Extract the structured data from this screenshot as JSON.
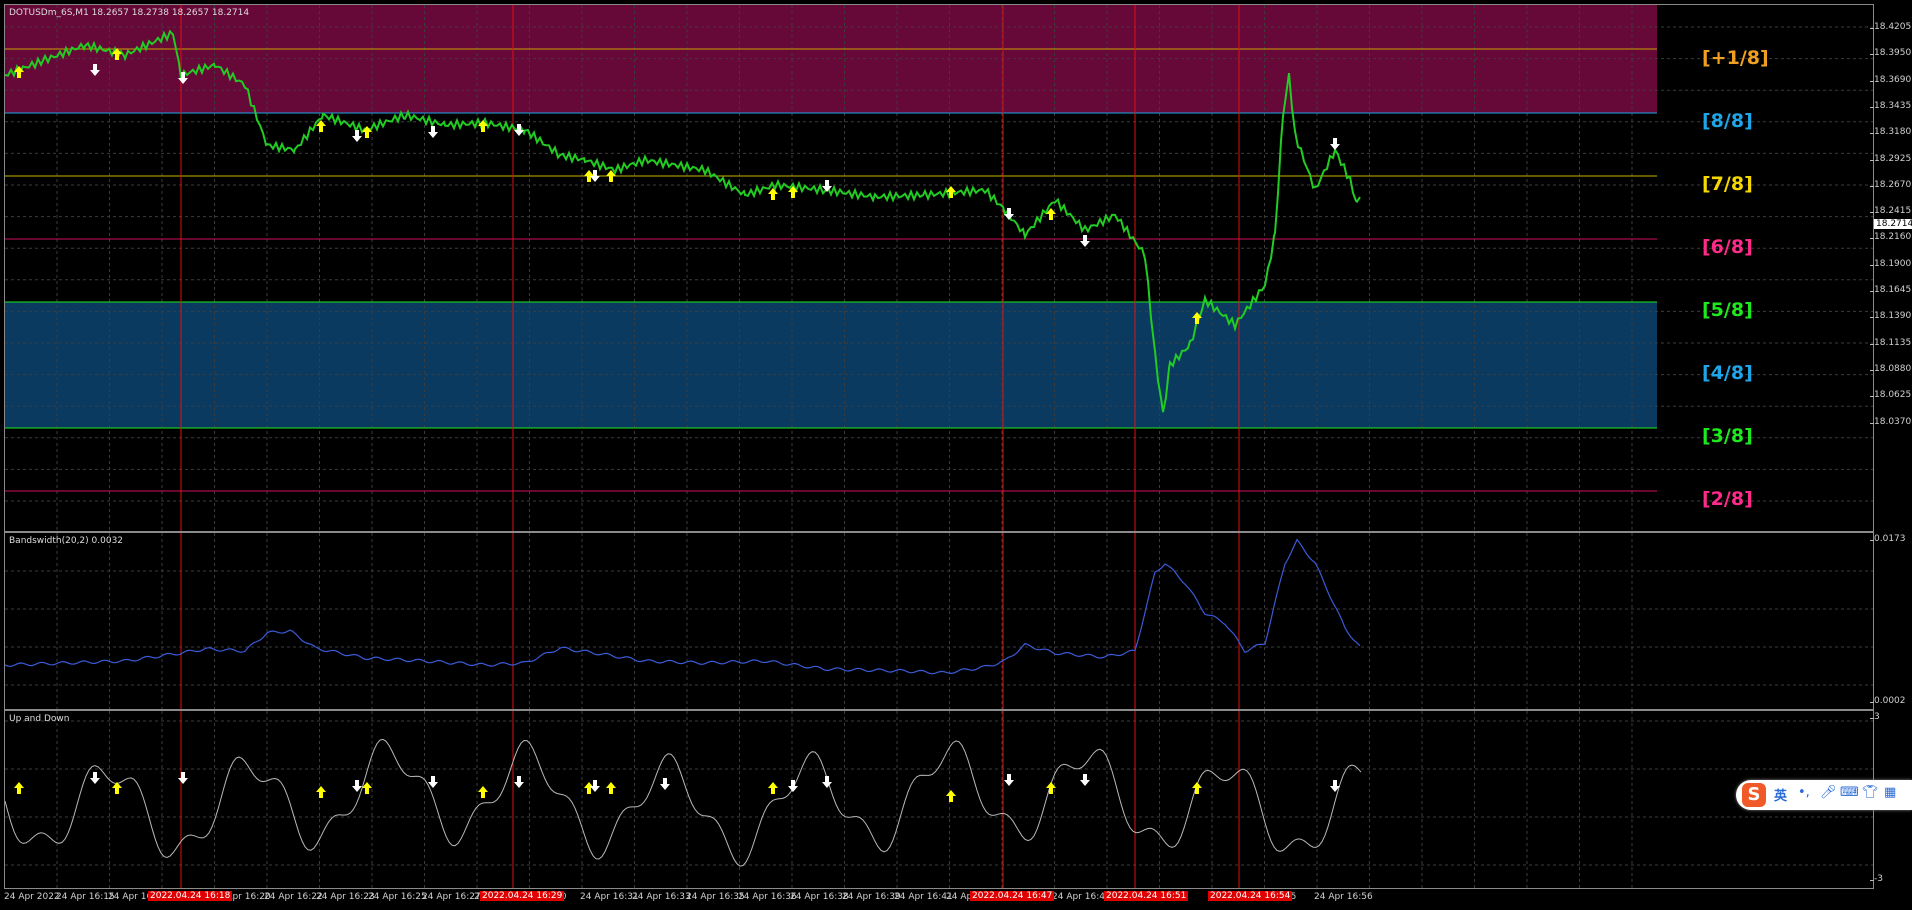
{
  "main": {
    "header": "DOTUSDm_6S,M1  18.2657 18.2738 18.2657 18.2714",
    "price_axis": [
      "18.4205",
      "18.3950",
      "18.3690",
      "18.3435",
      "18.3180",
      "18.2925",
      "18.2670",
      "18.2415",
      "18.2160",
      "18.1900",
      "18.1645",
      "18.1390",
      "18.1135",
      "18.0880",
      "18.0625",
      "18.0370"
    ],
    "current_price": "18.2714",
    "murrey_labels": [
      {
        "text": "[+1/8]",
        "color": "#f0a020"
      },
      {
        "text": "[8/8]",
        "color": "#1ea6e8"
      },
      {
        "text": "[7/8]",
        "color": "#f5d800"
      },
      {
        "text": "[6/8]",
        "color": "#ff2a8a"
      },
      {
        "text": "[5/8]",
        "color": "#1ee81e"
      },
      {
        "text": "[4/8]",
        "color": "#1ea6e8"
      },
      {
        "text": "[3/8]",
        "color": "#1ee81e"
      },
      {
        "text": "[2/8]",
        "color": "#ff2a8a"
      }
    ]
  },
  "bandwidth": {
    "header": "Bandswidth(20,2) 0.0032",
    "axis_top": "0.0173",
    "axis_bottom": "0.0002"
  },
  "updown": {
    "header": "Up and Down",
    "axis_top": "3",
    "axis_bottom": "-3"
  },
  "time_axis": {
    "labels": [
      "24 Apr 2022",
      "24 Apr 16:15",
      "24 Apr 16:1",
      "24 Apr 16:20",
      "24 Apr 16:22",
      "24 Apr 16:23",
      "24 Apr 16:25",
      "24 Apr 16:27",
      "2",
      "r 16:30",
      "24 Apr 16:31",
      "24 Apr 16:33",
      "24 Apr 16:35",
      "24 Apr 16:36",
      "24 Apr 16:38",
      "24 Apr 16:39",
      "24 Apr 16:41",
      "24 Apr",
      "47",
      "24 Apr 16:48",
      "Apr 16:51",
      "Apr 16:55",
      "24 Apr 16:56"
    ],
    "selected": [
      "2022.04.24 16:18",
      "2022.04.24 16:29",
      "2022.04.24 16:47",
      "2022.04.24 16:51",
      "2022.04.24 16:54"
    ]
  },
  "colors": {
    "candle": "#22cc22",
    "purple_zone": "#660838",
    "blue_zone": "#0a3a60",
    "vline": "#e01010",
    "bandwidth_line": "#3b5ad8",
    "updown_line": "#b8b8b8",
    "arrow_up": "#ffff00",
    "arrow_down": "#ffffff"
  },
  "ime_toolbar": {
    "logo": "S",
    "lang": "英",
    "items": [
      "punct-icon",
      "mic-icon",
      "keyboard-icon",
      "skin-icon",
      "apps-icon"
    ]
  }
}
